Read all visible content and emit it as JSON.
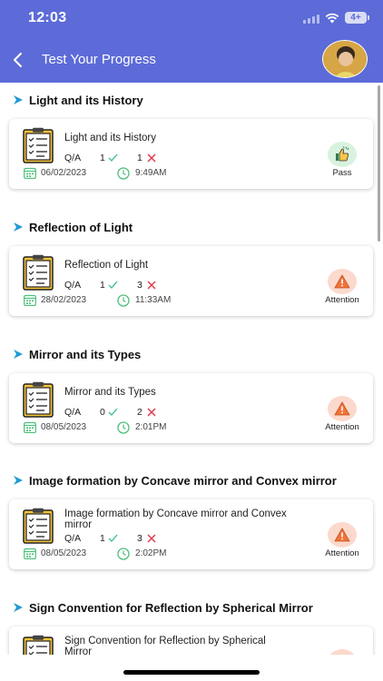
{
  "status_bar": {
    "time": "12:03",
    "battery": "4+"
  },
  "header": {
    "title": "Test Your Progress"
  },
  "colors": {
    "header_bg": "#5c6bd8",
    "pass_bg": "#d8f2df",
    "attention_bg": "#fbd9cc",
    "correct": "#3fbf8a",
    "wrong": "#e23a4f",
    "calendar": "#4bbf7b",
    "clock": "#4bbf7b"
  },
  "sections": [
    {
      "heading": "Light and its History",
      "card": {
        "title": "Light and its History",
        "qa_label": "Q/A",
        "correct": "1",
        "wrong": "1",
        "date": "06/02/2023",
        "time": "9:49AM",
        "status": "Pass",
        "status_icon": "thumbs-up-icon"
      }
    },
    {
      "heading": "Reflection of Light",
      "card": {
        "title": "Reflection of Light",
        "qa_label": "Q/A",
        "correct": "1",
        "wrong": "3",
        "date": "28/02/2023",
        "time": "11:33AM",
        "status": "Attention",
        "status_icon": "warning-icon"
      }
    },
    {
      "heading": "Mirror and its Types",
      "card": {
        "title": "Mirror and its Types",
        "qa_label": "Q/A",
        "correct": "0",
        "wrong": "2",
        "date": "08/05/2023",
        "time": "2:01PM",
        "status": "Attention",
        "status_icon": "warning-icon"
      }
    },
    {
      "heading": "Image formation by Concave mirror and Convex mirror",
      "card": {
        "title": "Image formation by Concave mirror and Convex mirror",
        "qa_label": "Q/A",
        "correct": "1",
        "wrong": "3",
        "date": "08/05/2023",
        "time": "2:02PM",
        "status": "Attention",
        "status_icon": "warning-icon"
      }
    },
    {
      "heading": "Sign Convention for Reflection by Spherical Mirror",
      "card": {
        "title": "Sign Convention for Reflection by Spherical Mirror",
        "qa_label": "",
        "correct": "",
        "wrong": "",
        "date": "",
        "time": "",
        "status": "",
        "status_icon": "warning-icon"
      }
    }
  ]
}
